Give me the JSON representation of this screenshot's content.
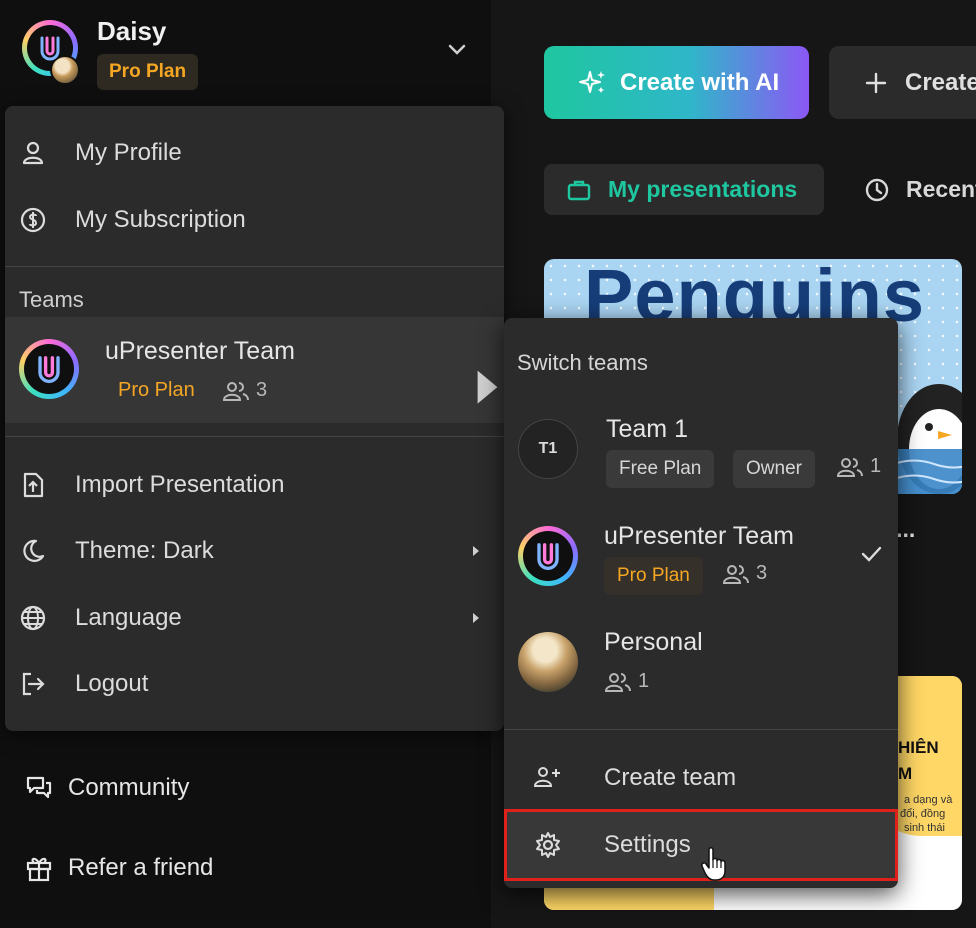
{
  "user": {
    "name": "Daisy",
    "plan": "Pro Plan"
  },
  "profile_menu": {
    "items_top": [
      {
        "label": "My Profile",
        "icon": "person-icon"
      },
      {
        "label": "My Subscription",
        "icon": "dollar-circle-icon"
      }
    ],
    "teams_label": "Teams",
    "current_team": {
      "name": "uPresenter Team",
      "plan": "Pro Plan",
      "members": "3"
    },
    "items_bottom": [
      {
        "label": "Import Presentation",
        "icon": "file-upload-icon"
      },
      {
        "label": "Theme: Dark",
        "icon": "moon-icon"
      },
      {
        "label": "Language",
        "icon": "globe-icon"
      },
      {
        "label": "Logout",
        "icon": "logout-icon"
      }
    ]
  },
  "sidebar_links": [
    {
      "label": "Community",
      "icon": "chat-icon"
    },
    {
      "label": "Refer a friend",
      "icon": "gift-icon"
    }
  ],
  "main": {
    "create_ai_label": "Create with AI",
    "create_label": "Create",
    "tab_mine_label": "My presentations",
    "tab_recent_label": "Recent",
    "card1_title": "Penguins",
    "card1_caption": "tio...",
    "card2_title_1": "HIÊN",
    "card2_title_2": "M",
    "card2_text_1": "a dạng và",
    "card2_text_2": " đổi, đồng",
    "card2_text_3": "sinh thái"
  },
  "switch_teams": {
    "title": "Switch teams",
    "teams": [
      {
        "initials": "T1",
        "name": "Team 1",
        "plan": "Free Plan",
        "role": "Owner",
        "members": "1"
      },
      {
        "name": "uPresenter Team",
        "plan": "Pro Plan",
        "members": "3",
        "selected": true
      },
      {
        "name": "Personal",
        "members": "1"
      }
    ],
    "create_team_label": "Create team",
    "settings_label": "Settings"
  },
  "colors": {
    "accent_green": "#1fc7a0",
    "pro_orange": "#f5a623",
    "highlight_red": "#e0201b",
    "menu_bg": "#2b2b2b"
  }
}
